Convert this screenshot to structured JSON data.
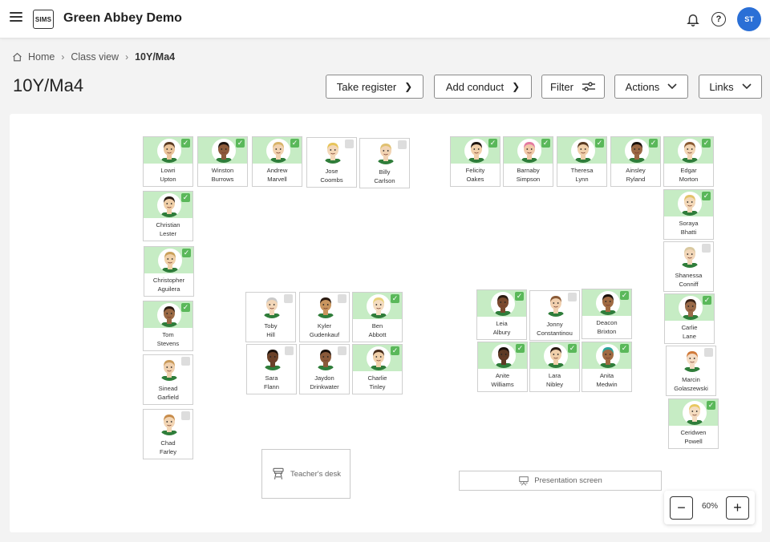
{
  "header": {
    "logo_text": "SIMS",
    "app_title": "Green Abbey Demo",
    "avatar_initials": "ST"
  },
  "breadcrumb": {
    "home": "Home",
    "class_view": "Class view",
    "current": "10Y/Ma4"
  },
  "page_title": "10Y/Ma4",
  "toolbar": {
    "take_register": "Take register",
    "add_conduct": "Add conduct",
    "filter": "Filter",
    "actions": "Actions",
    "links": "Links"
  },
  "classroom": {
    "teacher_desk": "Teacher's desk",
    "presentation_screen": "Presentation screen",
    "zoom_level": "60%"
  },
  "colors": {
    "present": "#c6ecc4",
    "check": "#5ab85a",
    "accent": "#2a6fd6"
  },
  "students": [
    {
      "first": "Lowri",
      "last": "Upton",
      "present": true,
      "skin": "#e9c39a",
      "hair": "#5a3a22"
    },
    {
      "first": "Winston",
      "last": "Burrows",
      "present": true,
      "skin": "#8d5a3b",
      "hair": "#1e1410"
    },
    {
      "first": "Andrew",
      "last": "Marvell",
      "present": true,
      "skin": "#f1d2b0",
      "hair": "#d8b46a"
    },
    {
      "first": "Jose",
      "last": "Coombs",
      "present": false,
      "skin": "#f3d7b8",
      "hair": "#e7c45a"
    },
    {
      "first": "Billy",
      "last": "Carlson",
      "present": false,
      "skin": "#f1d3b3",
      "hair": "#e0c070"
    },
    {
      "first": "Christian",
      "last": "Lester",
      "present": true,
      "skin": "#f0cfa8",
      "hair": "#2a1c14"
    },
    {
      "first": "Christopher",
      "last": "Aguilera",
      "present": true,
      "skin": "#f0d0a8",
      "hair": "#c9a05a"
    },
    {
      "first": "Tom",
      "last": "Stevens",
      "present": true,
      "skin": "#9b6a45",
      "hair": "#2a1a10"
    },
    {
      "first": "Sinead",
      "last": "Garfield",
      "present": false,
      "skin": "#f0d0ae",
      "hair": "#c99a5a"
    },
    {
      "first": "Chad",
      "last": "Farley",
      "present": false,
      "skin": "#f2d5b4",
      "hair": "#c88c4a"
    },
    {
      "first": "Toby",
      "last": "Hill",
      "present": false,
      "skin": "#f2d6b8",
      "hair": "#c9c9c9"
    },
    {
      "first": "Kyler",
      "last": "Gudenkauf",
      "present": false,
      "skin": "#c9955e",
      "hair": "#2a1a10"
    },
    {
      "first": "Ben",
      "last": "Abbott",
      "present": true,
      "skin": "#f4dcc0",
      "hair": "#e8d27a"
    },
    {
      "first": "Sara",
      "last": "Flann",
      "present": false,
      "skin": "#6b4128",
      "hair": "#1a100a"
    },
    {
      "first": "Jaydon",
      "last": "Drinkwater",
      "present": false,
      "skin": "#8a5a3a",
      "hair": "#1a100a"
    },
    {
      "first": "Charlie",
      "last": "Tinley",
      "present": true,
      "skin": "#f0cfaa",
      "hair": "#4a2e1c"
    },
    {
      "first": "Felicity",
      "last": "Oakes",
      "present": true,
      "skin": "#f0cfaa",
      "hair": "#1e1410"
    },
    {
      "first": "Barnaby",
      "last": "Simpson",
      "present": true,
      "skin": "#f0c8a8",
      "hair": "#e47aa0"
    },
    {
      "first": "Theresa",
      "last": "Lynn",
      "present": true,
      "skin": "#f0cfaa",
      "hair": "#5a3a22"
    },
    {
      "first": "Ainsley",
      "last": "Ryland",
      "present": true,
      "skin": "#9a6844",
      "hair": "#1a100a"
    },
    {
      "first": "Edgar",
      "last": "Morton",
      "present": true,
      "skin": "#f2d5b4",
      "hair": "#8a5a32"
    },
    {
      "first": "Soraya",
      "last": "Bhatti",
      "present": true,
      "skin": "#f3d8b8",
      "hair": "#e3c26a"
    },
    {
      "first": "Shanessa",
      "last": "Conniff",
      "present": false,
      "skin": "#f2d6b8",
      "hair": "#d9c9a0"
    },
    {
      "first": "Carlie",
      "last": "Lane",
      "present": true,
      "skin": "#9a6a48",
      "hair": "#3a2418"
    },
    {
      "first": "Marcin",
      "last": "Golaszewski",
      "present": false,
      "skin": "#f4dcc4",
      "hair": "#d07a3a"
    },
    {
      "first": "Ceridwen",
      "last": "Powell",
      "present": true,
      "skin": "#f4dcc0",
      "hair": "#e8c860"
    },
    {
      "first": "Leia",
      "last": "Albury",
      "present": true,
      "skin": "#7a4a2e",
      "hair": "#2a1a10"
    },
    {
      "first": "Jonny",
      "last": "Constantinou",
      "present": false,
      "skin": "#f0cfae",
      "hair": "#8a5a36"
    },
    {
      "first": "Deacon",
      "last": "Brixton",
      "present": true,
      "skin": "#a06a42",
      "hair": "#1a100a"
    },
    {
      "first": "Anite",
      "last": "Williams",
      "present": true,
      "skin": "#5e3a24",
      "hair": "#1a100a"
    },
    {
      "first": "Lara",
      "last": "Nibley",
      "present": true,
      "skin": "#f0cfaa",
      "hair": "#2a1a12"
    },
    {
      "first": "Anita",
      "last": "Medwin",
      "present": true,
      "skin": "#a06a42",
      "hair": "#2aa59a"
    }
  ]
}
